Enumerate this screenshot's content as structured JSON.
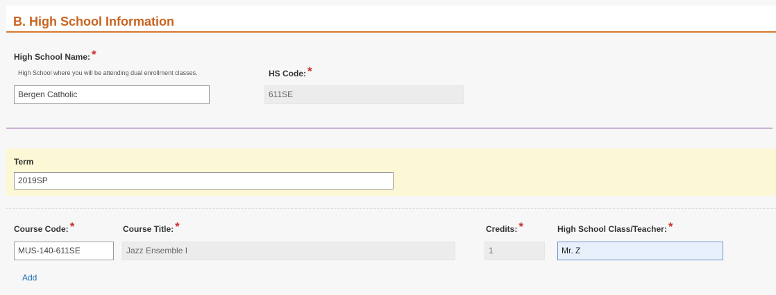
{
  "section": {
    "title": "B. High School Information"
  },
  "high_school": {
    "name_label": "High School Name:",
    "name_hint": "High School where you will be attending dual enrollment classes.",
    "name_value": "Bergen Catholic",
    "code_label": "HS Code:",
    "code_value": "611SE"
  },
  "required_marker": "*",
  "term": {
    "label": "Term",
    "value": "2019SP"
  },
  "course": {
    "code_label": "Course Code:",
    "code_value": "MUS-140-611SE",
    "title_label": "Course Title:",
    "title_value": "Jazz Ensemble I",
    "credits_label": "Credits:",
    "credits_value": "1",
    "teacher_label": "High School Class/Teacher:",
    "teacher_value": "Mr. Z",
    "add_label": "Add"
  },
  "colors": {
    "header_accent": "#d9772b",
    "title_text": "#c8641f",
    "required": "#c9302c",
    "divider": "#7a3a8e",
    "term_band": "#fcf7d5",
    "link": "#1a6db3"
  }
}
